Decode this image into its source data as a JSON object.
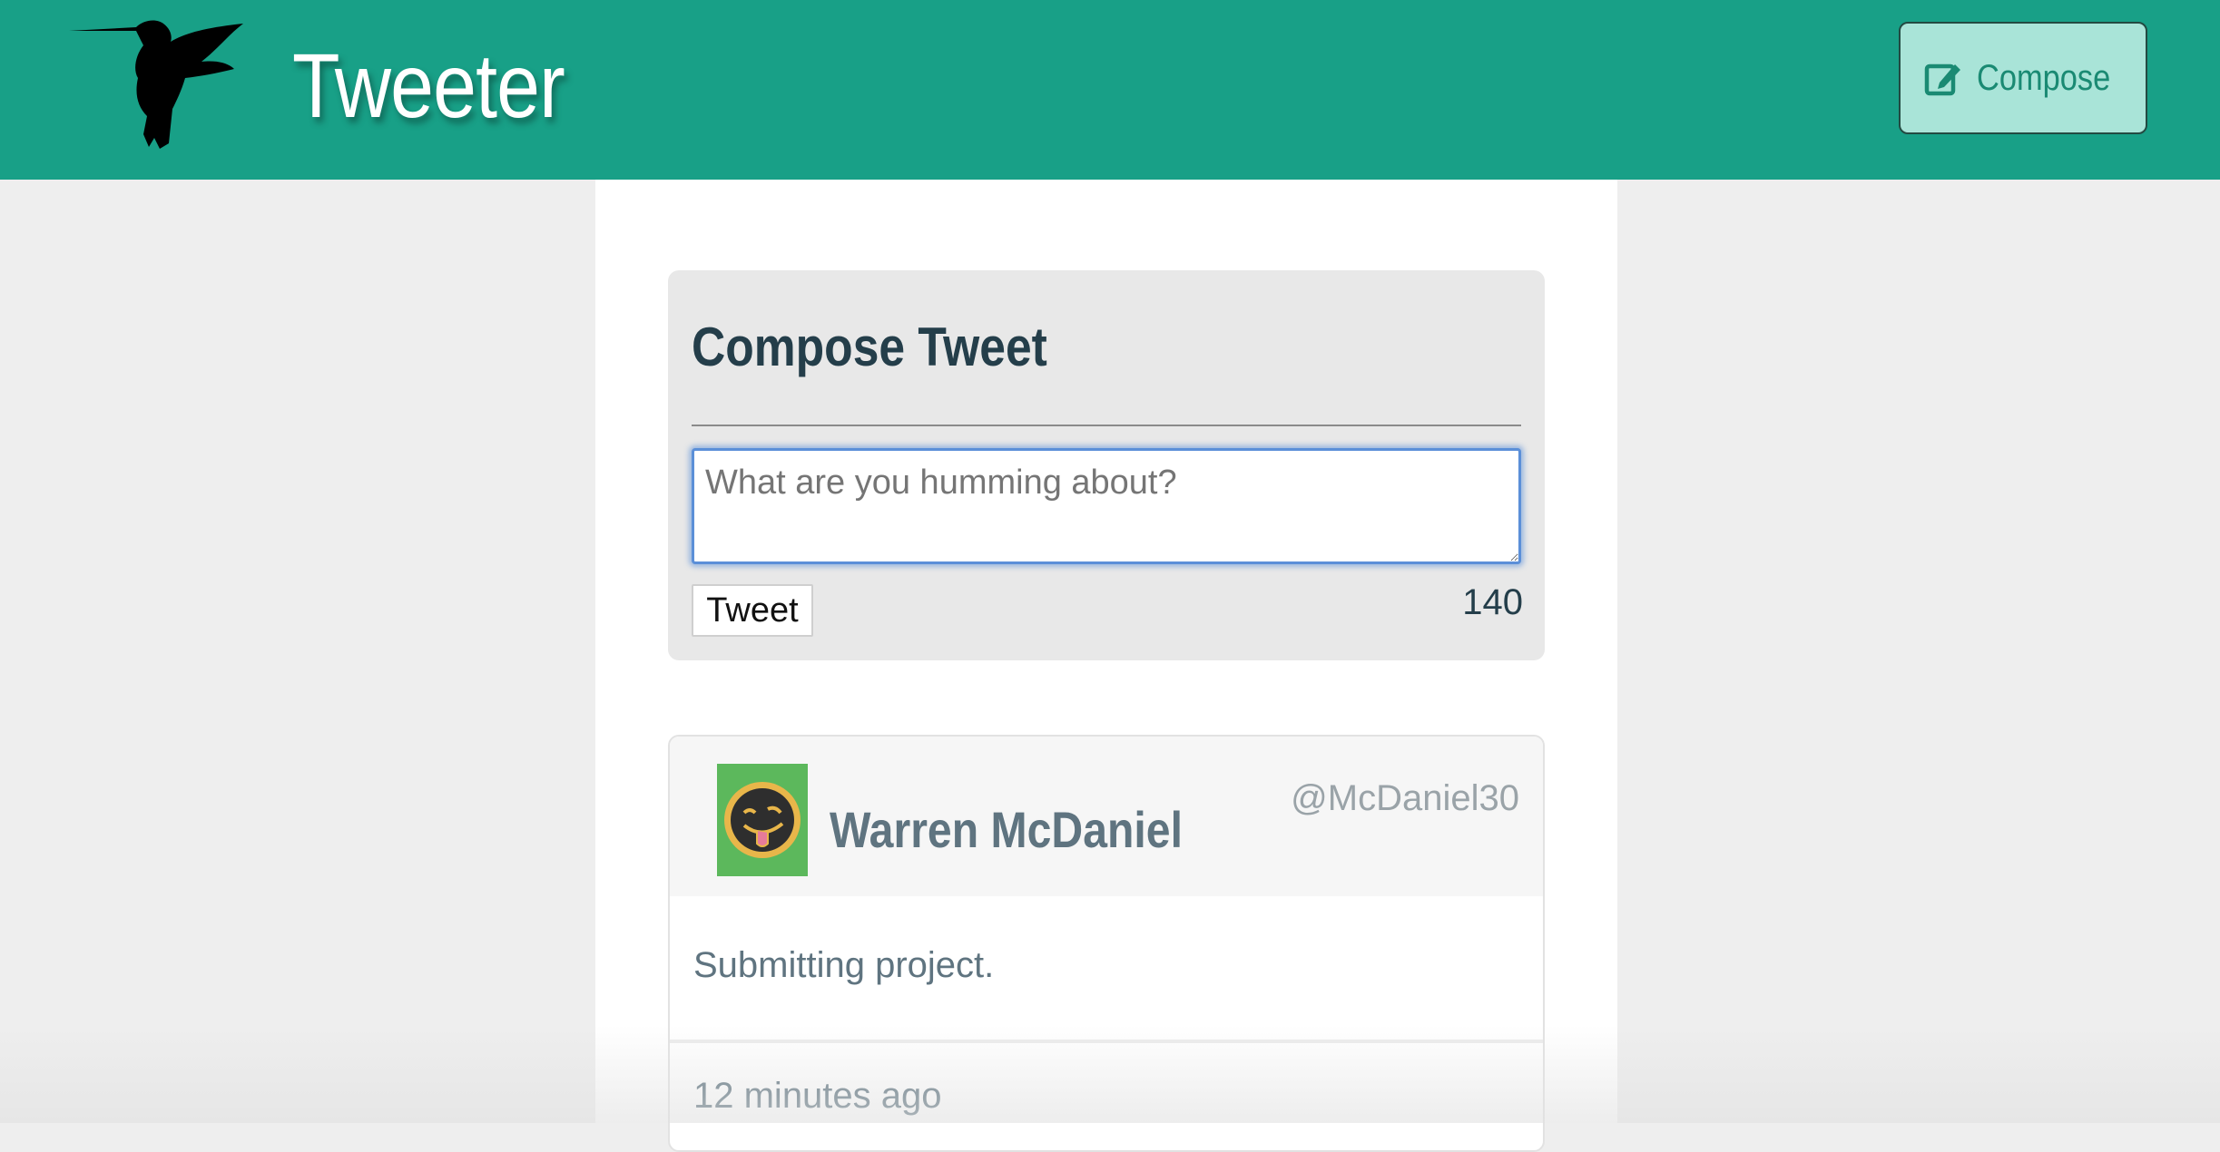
{
  "header": {
    "brand": "Tweeter",
    "logo_icon": "hummingbird-icon",
    "compose_icon": "edit-square-icon",
    "compose_label": "Compose",
    "background_color": "#18a087"
  },
  "composer": {
    "title": "Compose Tweet",
    "placeholder": "What are you humming about?",
    "submit_label": "Tweet",
    "char_count": "140"
  },
  "tweets": [
    {
      "avatar_icon": "smiley-tongue-avatar",
      "name": "Warren McDaniel",
      "handle": "@McDaniel30",
      "content": "Submitting project.",
      "time_ago": "12 minutes ago"
    }
  ]
}
